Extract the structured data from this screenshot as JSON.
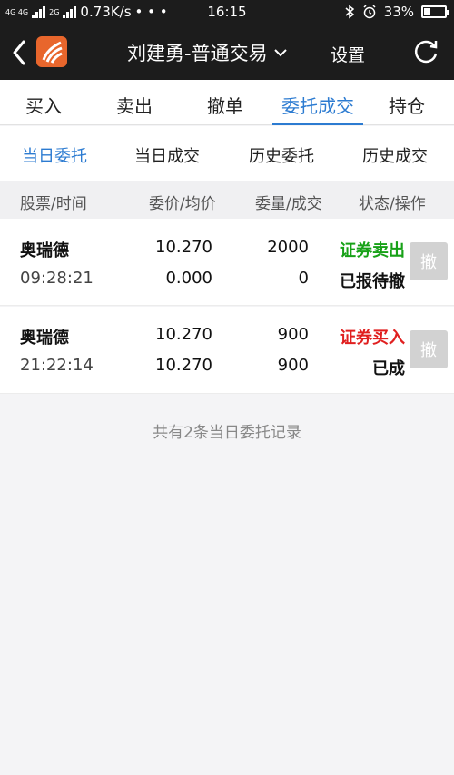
{
  "statusbar": {
    "network_label": "4G 4G",
    "network2_label": "2G",
    "speed": "0.73K/s",
    "dots": "• • •",
    "time": "16:15",
    "battery": "33%",
    "battery_level": 0.33
  },
  "nav": {
    "title": "刘建勇-普通交易",
    "settings_label": "设置"
  },
  "tabs": [
    "买入",
    "卖出",
    "撤单",
    "委托成交",
    "持仓"
  ],
  "subtabs": [
    "当日委托",
    "当日成交",
    "历史委托",
    "历史成交"
  ],
  "table": {
    "headers": [
      "股票/时间",
      "委价/均价",
      "委量/成交",
      "状态/操作"
    ],
    "rows": [
      {
        "stock": "奥瑞德",
        "time": "09:28:21",
        "order_price": "10.270",
        "avg_price": "0.000",
        "order_qty": "2000",
        "filled_qty": "0",
        "type": "证券卖出",
        "type_color": "#17a117",
        "status": "已报待撤",
        "action": "撤"
      },
      {
        "stock": "奥瑞德",
        "time": "21:22:14",
        "order_price": "10.270",
        "avg_price": "10.270",
        "order_qty": "900",
        "filled_qty": "900",
        "type": "证券买入",
        "type_color": "#e02020",
        "status": "已成",
        "action": "撤"
      }
    ]
  },
  "footer_note": "共有2条当日委托记录"
}
